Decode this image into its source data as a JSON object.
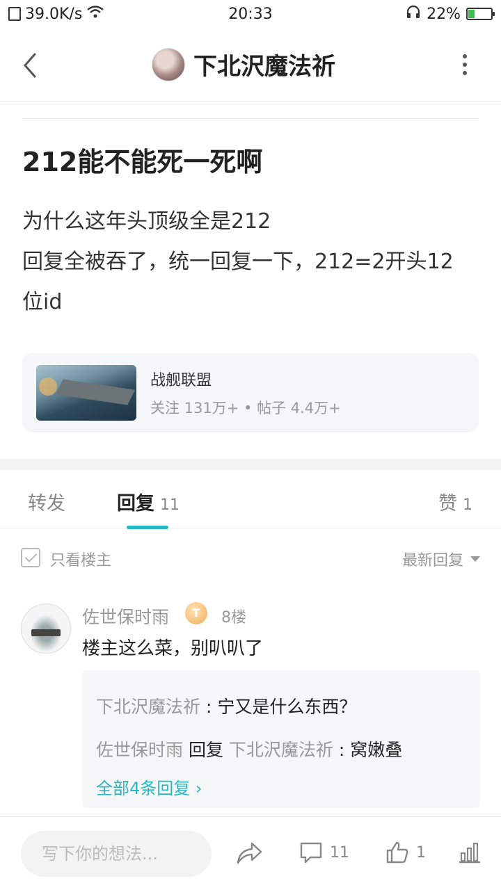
{
  "status_bar": {
    "speed": "39.0K/s",
    "time": "20:33",
    "battery": "22%"
  },
  "nav": {
    "title": "下北沢魔法祈"
  },
  "post": {
    "title": "212能不能死一死啊",
    "body_lines": [
      "为什么这年头顶级全是212",
      "回复全被吞了，统一回复一下，212=2开头12",
      "位id"
    ]
  },
  "forum": {
    "name": "战舰联盟",
    "stats": "关注 131万+ • 帖子 4.4万+"
  },
  "tabs": {
    "forward": "转发",
    "reply": "回复",
    "reply_count": "11",
    "like": "赞",
    "like_count": "1"
  },
  "filter": {
    "only_op": "只看楼主",
    "sort": "最新回复"
  },
  "reply": {
    "author": "佐世保时雨",
    "badge": "T",
    "floor": "8楼",
    "content": "楼主这么菜，别叭叭了",
    "subs": [
      {
        "name": "下北沢魔法祈",
        "sep": " : ",
        "text": "宁又是什么东西？"
      },
      {
        "name": "佐世保时雨",
        "mid": " 回复 ",
        "name2": "下北沢魔法祈",
        "sep": " : ",
        "text": "窝嫩叠"
      }
    ],
    "more": "全部4条回复 ›"
  },
  "bottom": {
    "placeholder": "写下你的想法...",
    "comment_count": "11",
    "like_count": "1"
  }
}
